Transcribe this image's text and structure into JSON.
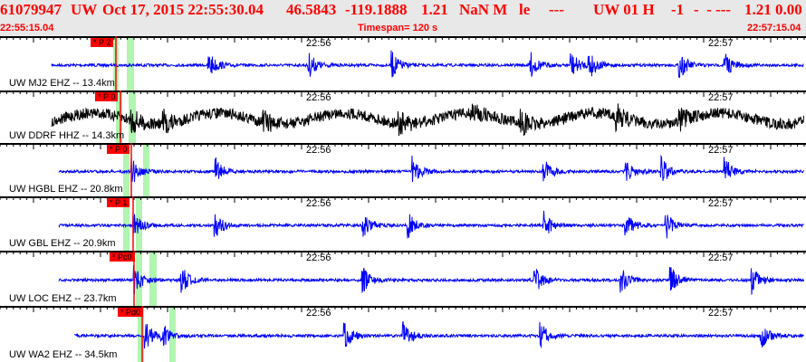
{
  "header": {
    "event_id": "61079947",
    "network": "UW",
    "origin_time": "Oct 17, 2015 22:55:30.04",
    "latitude": "46.5843",
    "longitude": "-119.1888",
    "depth": "1.21",
    "magnitude": "NaN M",
    "event_type": "le",
    "flag1": "---",
    "source": "UW 01 H",
    "quality": "-1",
    "flag2": "-  - ---",
    "values": "1.21 0.00",
    "start_time": "22:55:15.04",
    "timespan": "Timespan= 120 s",
    "end_time": "22:57:15.04"
  },
  "time_labels": [
    "22:56",
    "22:57"
  ],
  "colors": {
    "header_text": "#ff0000",
    "trace": "#0000ff",
    "trace_broadband": "#000000",
    "pick": "#ff0000",
    "window": "#b0f5b0"
  },
  "traces": [
    {
      "station": "UW MJ2 EHZ -- 13.4km",
      "pick": "* P 2",
      "color": "#0000ff"
    },
    {
      "station": "UW DDRF HHZ -- 14.3km",
      "pick": "* P 0",
      "color": "#000000"
    },
    {
      "station": "UW HGBL EHZ -- 20.8km",
      "pick": "* P 0",
      "color": "#0000ff"
    },
    {
      "station": "UW GBL EHZ -- 20.9km",
      "pick": "* P 1",
      "color": "#0000ff"
    },
    {
      "station": "UW LOC EHZ -- 23.7km",
      "pick": "* Pc0",
      "color": "#0000ff"
    },
    {
      "station": "UW WA2 EHZ -- 34.5km",
      "pick": "* Pd0",
      "color": "#0000ff"
    }
  ]
}
